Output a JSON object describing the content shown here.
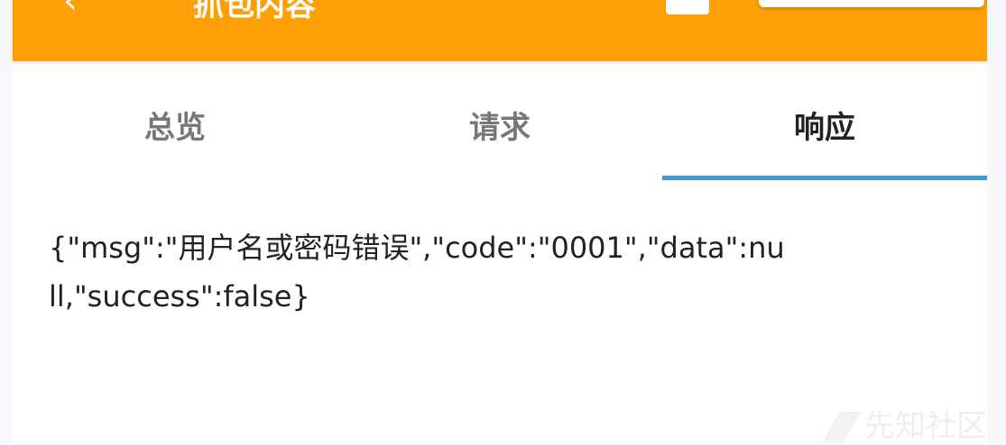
{
  "appbar": {
    "title": "抓包内容"
  },
  "tabs": [
    {
      "label": "总览"
    },
    {
      "label": "请求"
    },
    {
      "label": "响应"
    }
  ],
  "response": {
    "body": "{\"msg\":\"用户名或密码错误\",\"code\":\"0001\",\"data\":null,\"success\":false}"
  },
  "watermark": "先知社区"
}
